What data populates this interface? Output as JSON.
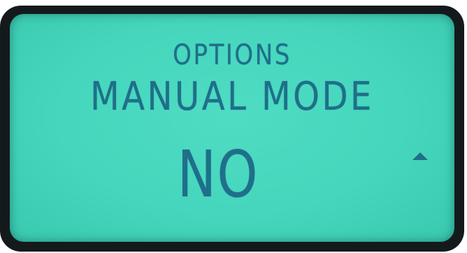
{
  "display": {
    "title": "OPTIONS",
    "setting_name": "MANUAL MODE",
    "setting_value": "NO",
    "indicator_icon": "up-arrow-icon",
    "colors": {
      "lcd_background": "#45d6bd",
      "segment_text": "#1f6f8a",
      "bezel": "#141a1c"
    }
  }
}
